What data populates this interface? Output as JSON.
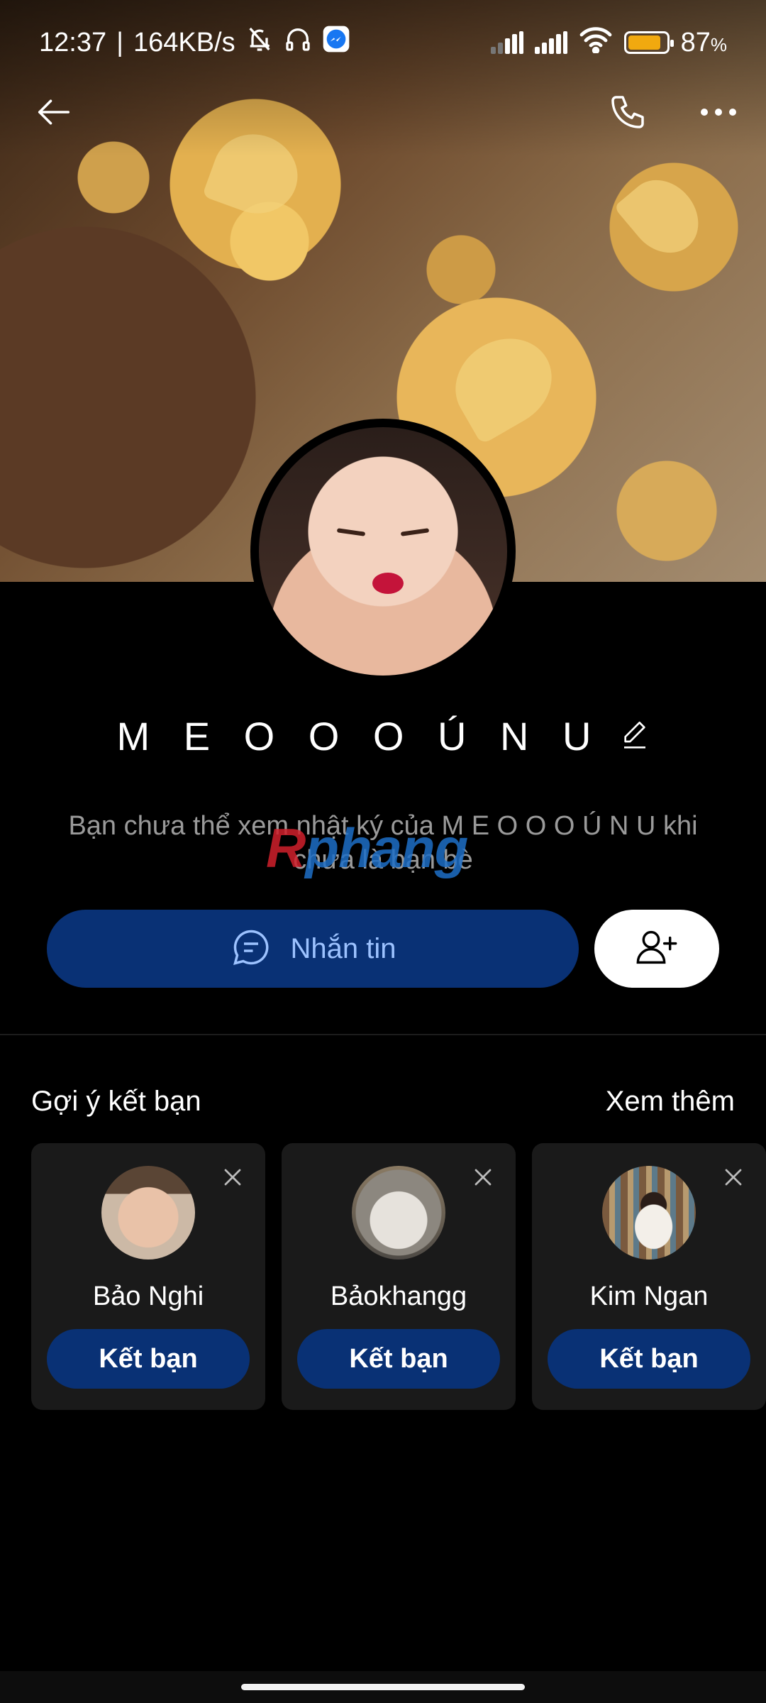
{
  "status_bar": {
    "time": "12:37",
    "speed": "164KB/s",
    "separator": "|",
    "battery_percent": "87",
    "percent_sign": "%",
    "icons": [
      "mute-bell-icon",
      "headphones-icon",
      "messenger-icon",
      "signal-icon",
      "signal-icon",
      "wifi-icon",
      "battery-icon"
    ]
  },
  "header": {
    "back_icon": "back-arrow-icon",
    "call_icon": "phone-icon",
    "more_icon": "more-dots-icon"
  },
  "profile": {
    "name": "M E O O O Ú N U",
    "edit_icon": "pencil-icon",
    "diary_note": "Bạn chưa thể xem nhật ký của M E O O O Ú N U khi chưa là bạn bè",
    "watermark_red": "R",
    "watermark_blue": "phang"
  },
  "actions": {
    "message_label": "Nhắn tin",
    "message_icon": "chat-bubble-icon",
    "add_friend_icon": "add-user-icon"
  },
  "suggestions": {
    "title": "Gợi ý kết bạn",
    "see_more": "Xem thêm",
    "items": [
      {
        "name": "Bảo Nghi",
        "button": "Kết bạn"
      },
      {
        "name": "Bảokhangg",
        "button": "Kết bạn"
      },
      {
        "name": "Kim Ngan",
        "button": "Kết bạn"
      }
    ]
  },
  "colors": {
    "background": "#000000",
    "primary_button": "#093175",
    "primary_text": "#9cc2ff",
    "card_bg": "#1a1a1a",
    "battery": "#f1a90f"
  }
}
